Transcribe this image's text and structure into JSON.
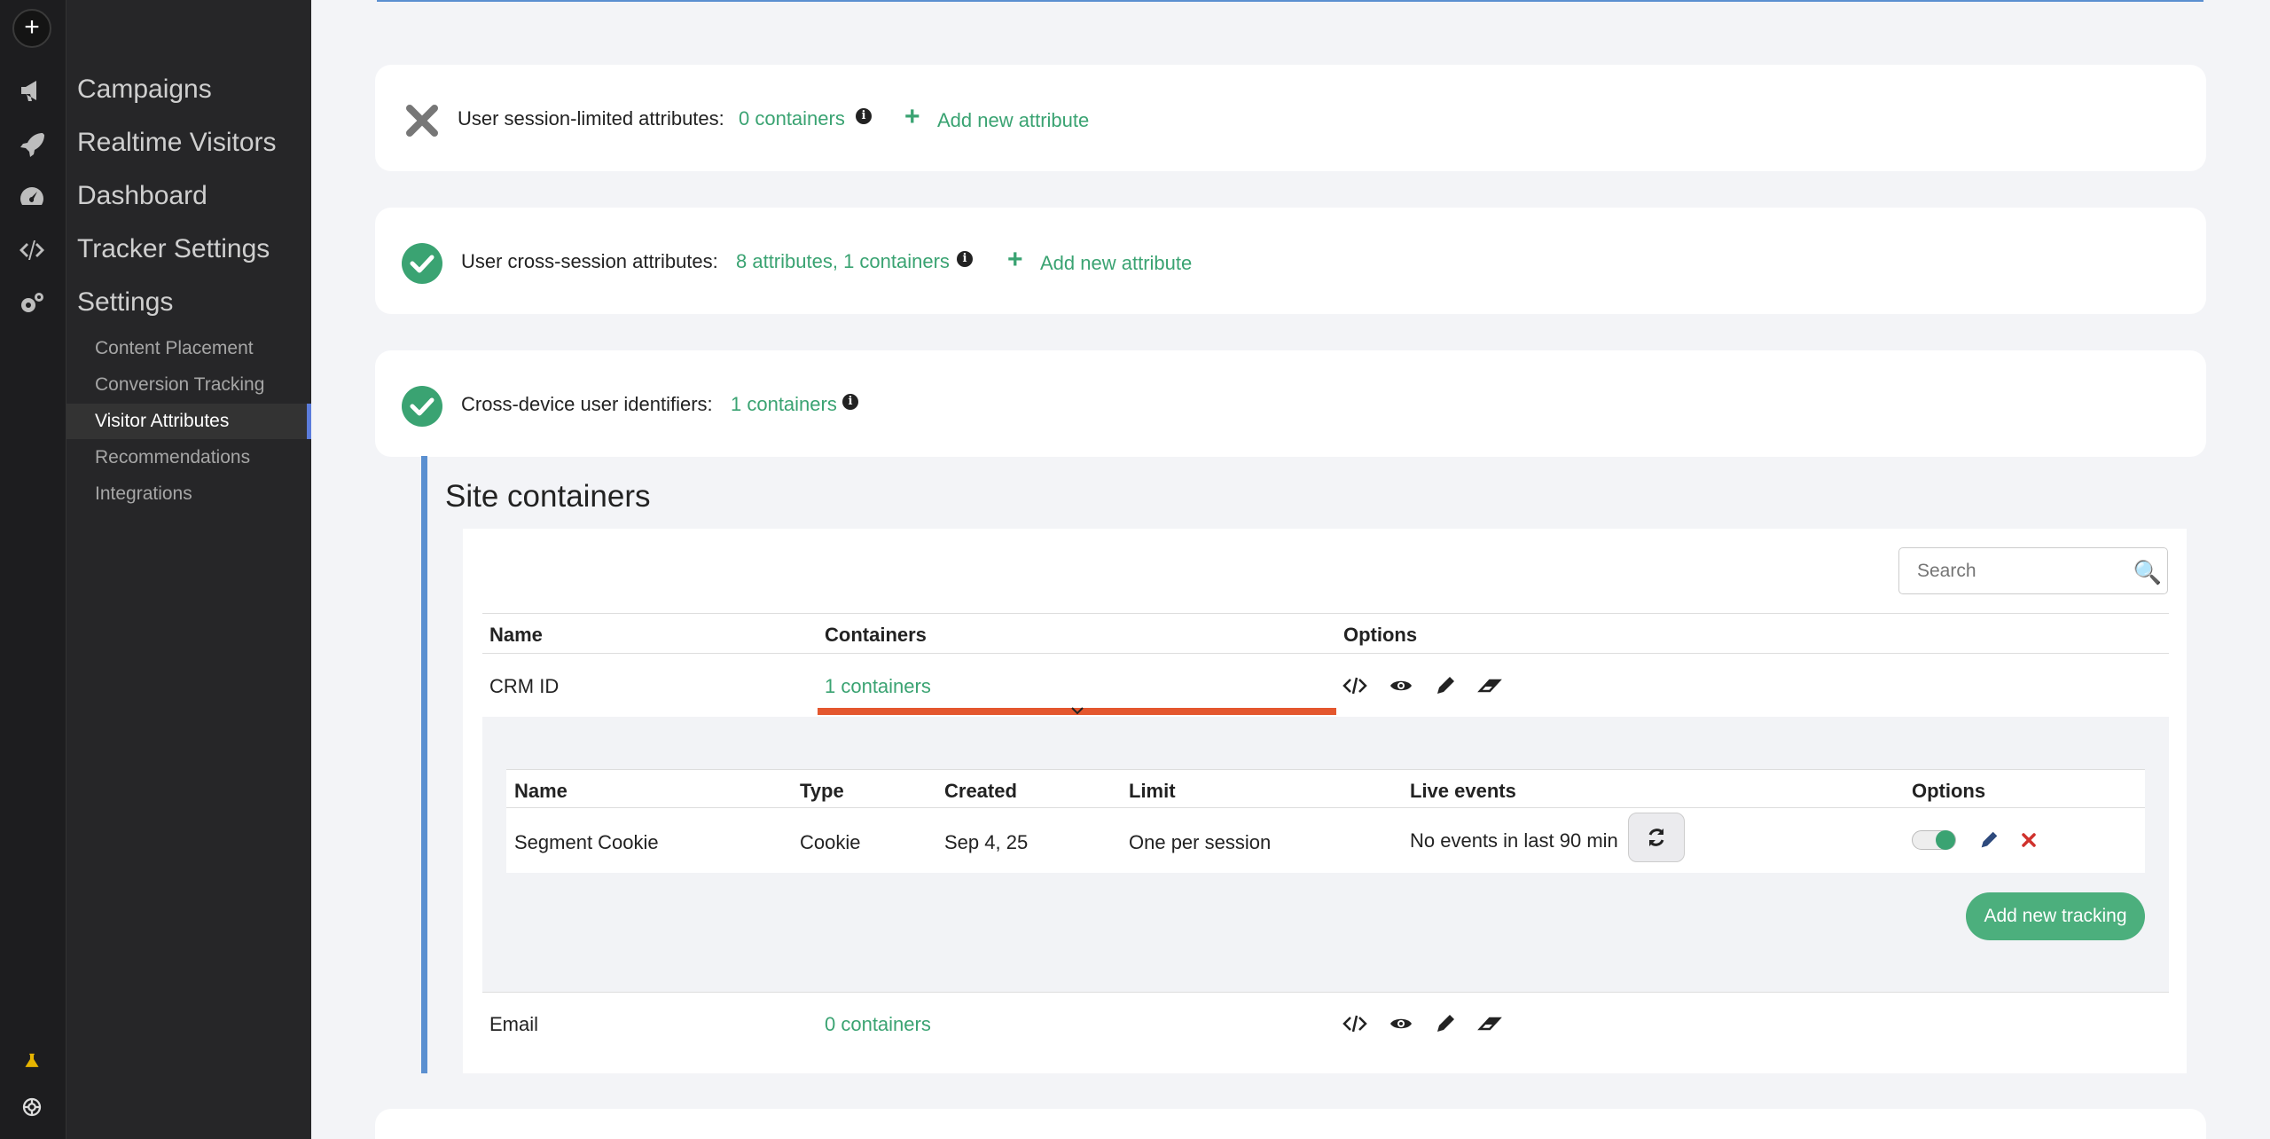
{
  "sidebar": {
    "main_items": [
      {
        "label": "Campaigns",
        "icon": "megaphone-icon"
      },
      {
        "label": "Realtime Visitors",
        "icon": "rocket-icon"
      },
      {
        "label": "Dashboard",
        "icon": "gauge-icon"
      },
      {
        "label": "Tracker Settings",
        "icon": "code-icon"
      },
      {
        "label": "Settings",
        "icon": "gears-icon"
      }
    ],
    "sub_items": [
      {
        "label": "Content Placement"
      },
      {
        "label": "Conversion Tracking"
      },
      {
        "label": "Visitor Attributes",
        "active": true
      },
      {
        "label": "Recommendations"
      },
      {
        "label": "Integrations"
      }
    ]
  },
  "cards": {
    "session": {
      "label": "User session-limited attributes:",
      "link": "0 containers",
      "add": "Add new attribute",
      "status": "disabled"
    },
    "cross_session": {
      "label": "User cross-session attributes:",
      "link": "8 attributes, 1 containers",
      "add": "Add new attribute",
      "status": "enabled"
    },
    "cross_device": {
      "label": "Cross-device user identifiers:",
      "link": "1 containers",
      "status": "enabled"
    }
  },
  "site_containers": {
    "title": "Site containers",
    "search_placeholder": "Search",
    "columns": [
      "Name",
      "Containers",
      "Options"
    ],
    "rows": [
      {
        "name": "CRM ID",
        "containers": "1 containers"
      },
      {
        "name": "Email",
        "containers": "0 containers"
      }
    ],
    "inner": {
      "columns": [
        "Name",
        "Type",
        "Created",
        "Limit",
        "Live events",
        "Options"
      ],
      "row": {
        "name": "Segment Cookie",
        "type": "Cookie",
        "created": "Sep 4, 25",
        "limit": "One per session",
        "live_events": "No events in last 90 min"
      },
      "add_button": "Add new tracking"
    }
  },
  "colors": {
    "accent": "#3aa372",
    "highlight": "#e4572e",
    "blue": "#5a8fd0"
  }
}
